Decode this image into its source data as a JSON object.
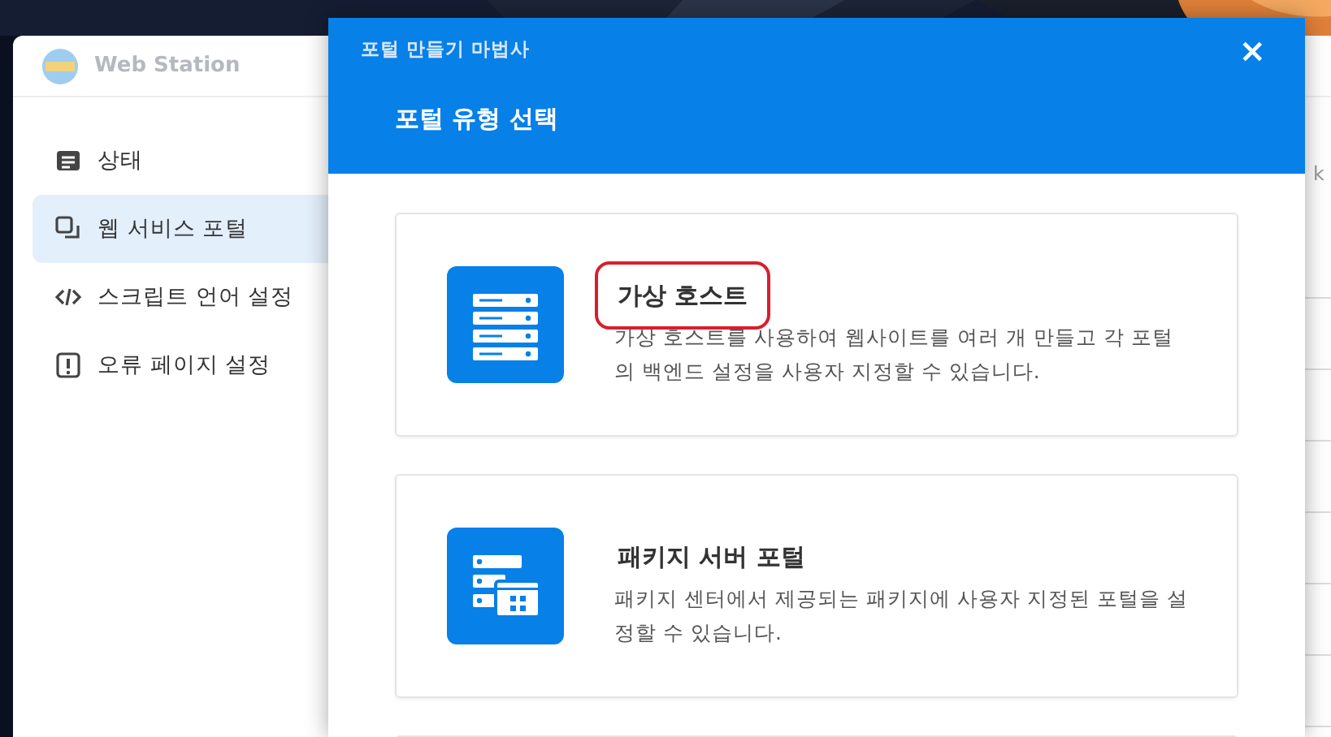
{
  "background_window": {
    "title": "Web Station",
    "sidebar": {
      "items": [
        {
          "label": "상태",
          "kind": "status",
          "selected": false
        },
        {
          "label": "웹 서비스 포털",
          "kind": "portal",
          "selected": true
        },
        {
          "label": "스크립트 언어 설정",
          "kind": "code",
          "selected": false
        },
        {
          "label": "오류 페이지 설정",
          "kind": "error",
          "selected": false
        }
      ]
    },
    "column_fragment": "k"
  },
  "dialog": {
    "title": "포털 만들기 마법사",
    "close": "×",
    "heading": "포털 유형 선택",
    "options": [
      {
        "kind": "virtual-host",
        "title": "가상 호스트",
        "description": "가상 호스트를 사용하여 웹사이트를 여러 개 만들고 각 포털의 백엔드 설정을 사용자 지정할 수 있습니다.",
        "highlighted": true
      },
      {
        "kind": "package-server",
        "title": "패키지 서버 포털",
        "description": "패키지 센터에서 제공되는 패키지에 사용자 지정된 포털을 설정할 수 있습니다.",
        "highlighted": false
      }
    ]
  }
}
